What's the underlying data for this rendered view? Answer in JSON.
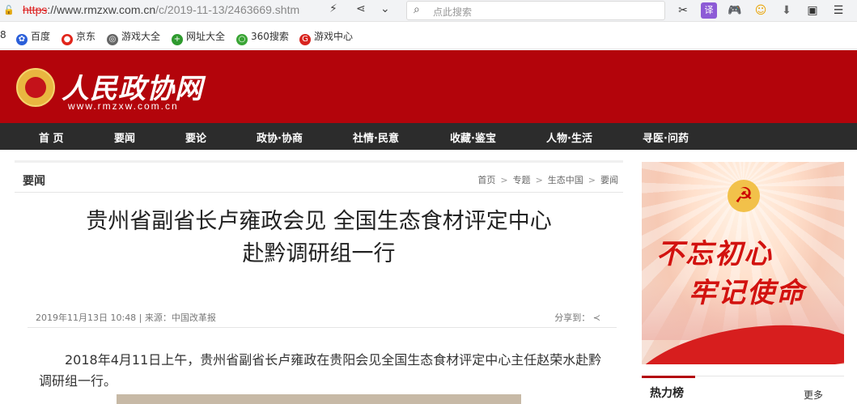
{
  "browser": {
    "url_scheme": "https",
    "url_rest": "://www.rmzxw.com.cn",
    "url_path": "/c/2019-11-13/2463669.shtm",
    "search_placeholder": "点此搜索"
  },
  "bookmarks": [
    {
      "label": "8"
    },
    {
      "label": "百度"
    },
    {
      "label": "京东"
    },
    {
      "label": "游戏大全"
    },
    {
      "label": "网址大全"
    },
    {
      "label": "360搜索"
    },
    {
      "label": "游戏中心"
    }
  ],
  "site": {
    "logo_text": "人民政协网",
    "logo_url": "www.rmzxw.com.cn"
  },
  "nav": [
    "首 页",
    "要闻",
    "要论",
    "政协·协商",
    "社情·民意",
    "收藏·鉴宝",
    "人物·生活",
    "寻医·问药"
  ],
  "article": {
    "section": "要闻",
    "breadcrumb": [
      "首页",
      "专题",
      "生态中国",
      "要闻"
    ],
    "title_line1": "贵州省副省长卢雍政会见 全国生态食材评定中心",
    "title_line2": "赴黔调研组一行",
    "meta": "2019年11月13日 10:48 | 来源：中国改革报",
    "share_label": "分享到：",
    "paragraph": "2018年4月11日上午，贵州省副省长卢雍政在贵阳会见全国生态食材评定中心主任赵荣水赴黔调研组一行。"
  },
  "sidebar": {
    "banner_slogan1": "不忘初心",
    "banner_slogan2": "牢记使命",
    "hot_title": "热力榜",
    "more_label": "更多"
  },
  "colors": {
    "brand_red": "#b3040b",
    "nav_bg": "#2c2c2c"
  }
}
